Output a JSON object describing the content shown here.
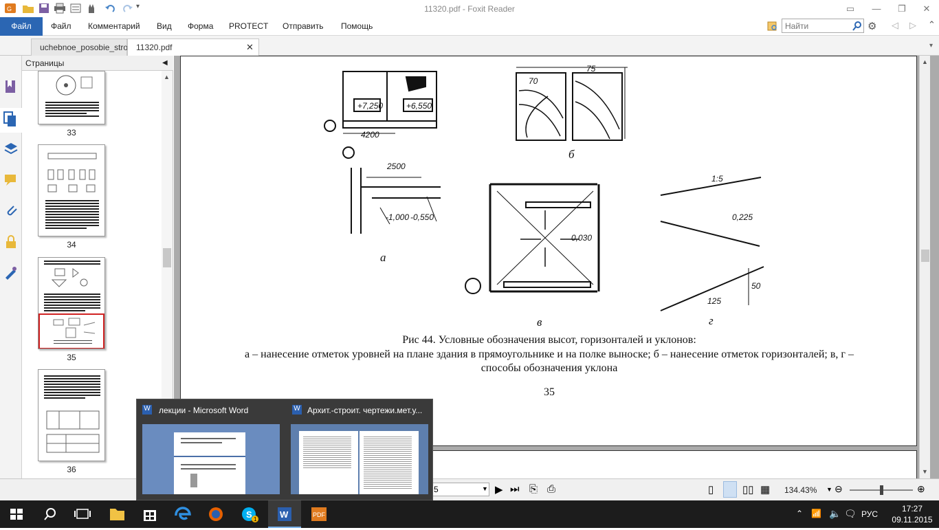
{
  "window": {
    "title": "11320.pdf - Foxit Reader"
  },
  "menu": {
    "file": "Файл",
    "items": [
      "Файл",
      "Комментарий",
      "Вид",
      "Форма",
      "PROTECT",
      "Отправить",
      "Помощь"
    ],
    "search_placeholder": "Найти"
  },
  "tabs": [
    {
      "label": "uchebnoe_posobie_stro..."
    },
    {
      "label": "11320.pdf"
    }
  ],
  "pages_panel": {
    "title": "Страницы",
    "pages": [
      "33",
      "34",
      "35",
      "36"
    ]
  },
  "document": {
    "figure": {
      "label_a": "а",
      "label_b": "б",
      "label_v": "в",
      "label_g": "г",
      "marks": [
        "+7,250",
        "+6,550",
        "4200",
        "2500",
        "-1,000",
        "-0,550",
        "0,030",
        "1:5",
        "0,225",
        "125",
        "50",
        "75",
        "70"
      ]
    },
    "caption_title": "Рис 44. Условные обозначения высот, горизонталей и уклонов:",
    "caption_body": "а – нанесение отметок уровней на плане здания в прямоугольнике и на полке выноске; б – нанесение отметок горизонталей; в, г – способы обозначения уклона",
    "page_number": "35"
  },
  "statusbar": {
    "page_field": "5",
    "zoom": "134.43%"
  },
  "taskbar_preview": {
    "items": [
      {
        "title": "лекции - Microsoft Word"
      },
      {
        "title": "Архит.-строит. чертежи.мет.у..."
      }
    ]
  },
  "tray": {
    "lang": "РУС",
    "time": "17:27",
    "date": "09.11.2015"
  }
}
